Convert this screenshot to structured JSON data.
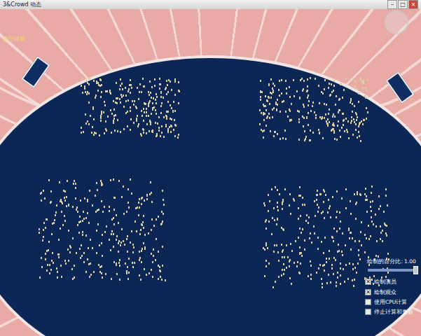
{
  "window": {
    "title": "3&Crowd 动态",
    "buttons": [
      "–",
      "□",
      "×"
    ]
  },
  "overlay_text": [
    "进行计算"
  ],
  "controls": {
    "slider": {
      "label": "绘制的百分比: 1.00",
      "level": 1.0
    },
    "checkboxes": [
      {
        "label": "绘制演员",
        "checked": true
      },
      {
        "label": "绘制观众",
        "checked": true
      },
      {
        "label": "使用CPU计算",
        "checked": false
      },
      {
        "label": "停止计算和更新",
        "checked": false
      }
    ]
  }
}
